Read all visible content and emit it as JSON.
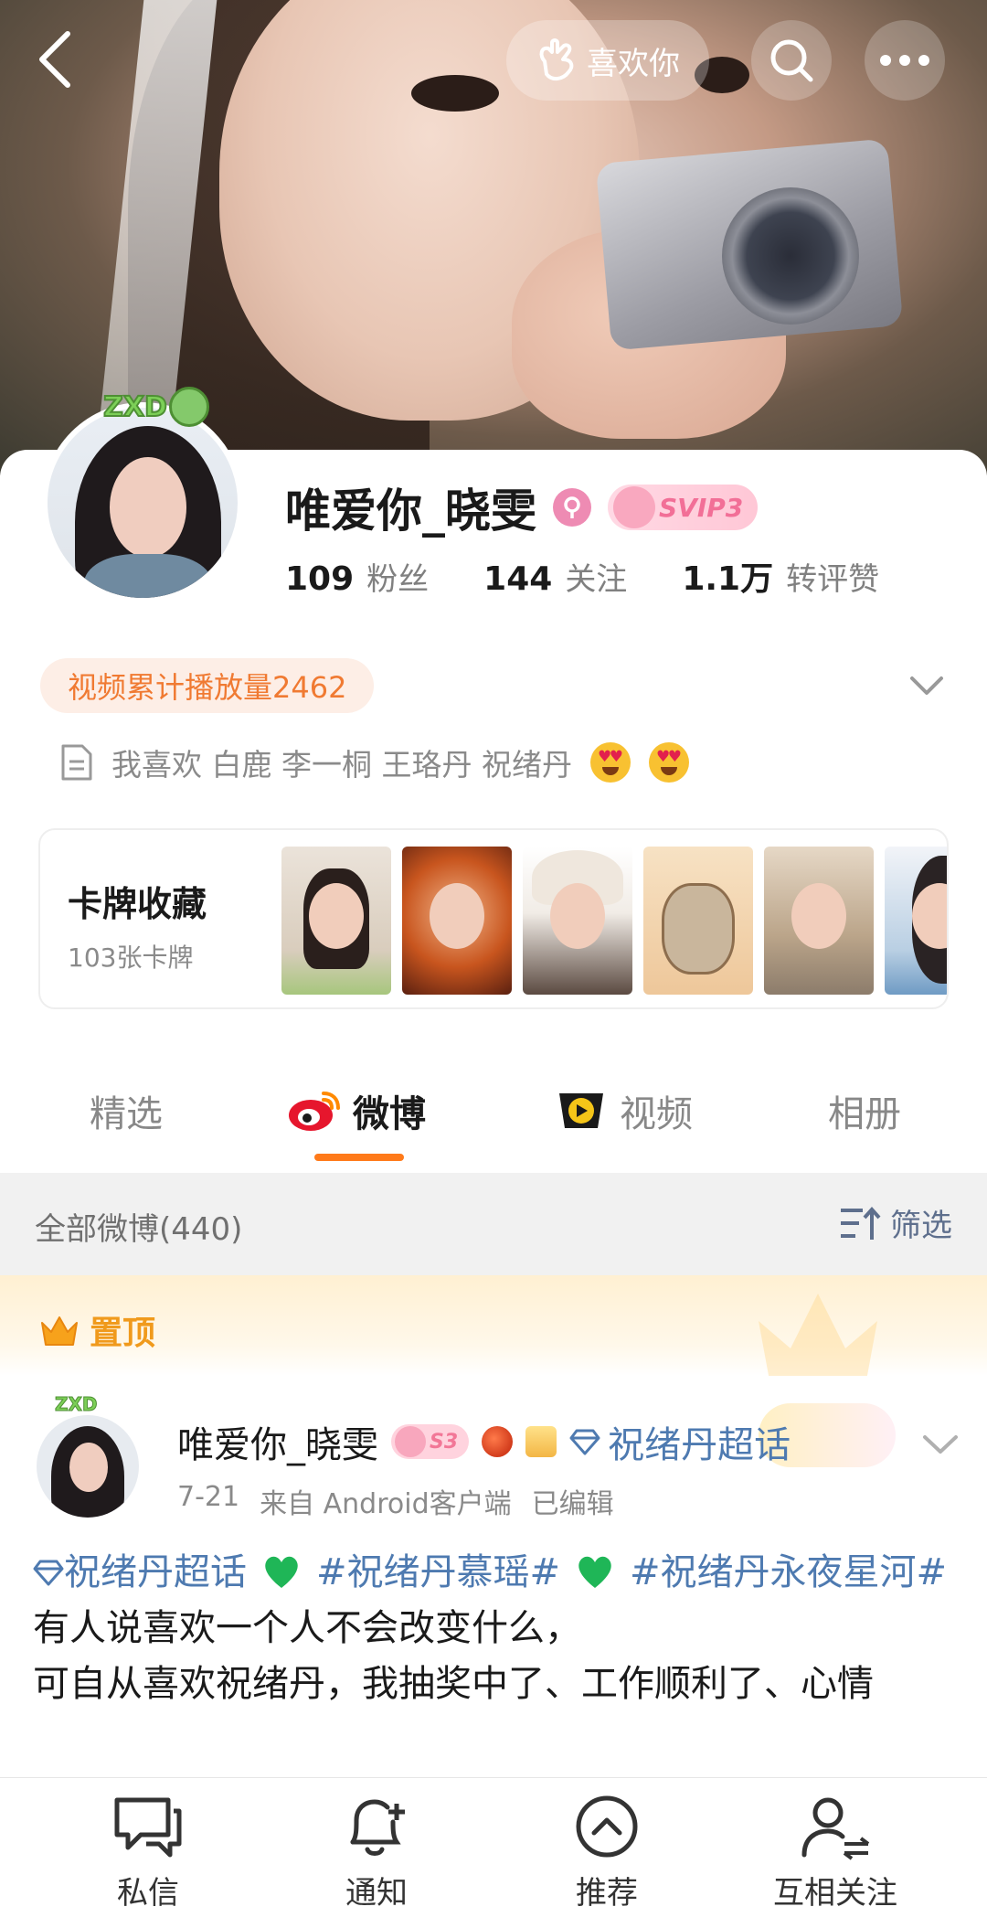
{
  "header": {
    "like_label": "喜欢你",
    "icons": {
      "back": "chevron-left-icon",
      "like": "hand-heart-icon",
      "search": "search-icon",
      "more": "more-dots-icon"
    }
  },
  "profile": {
    "avatar_badge": "ZXD",
    "name": "唯爱你_晓雯",
    "vip_label": "SVIP3",
    "stats": [
      {
        "num": "109",
        "label": "粉丝"
      },
      {
        "num": "144",
        "label": "关注"
      },
      {
        "num": "1.1万",
        "label": "转评赞"
      }
    ],
    "video_tag": "视频累计播放量2462",
    "bio": "我喜欢 白鹿 李一桐 王珞丹 祝绪丹",
    "bio_emoji": "heart-eyes-emoji"
  },
  "card_collection": {
    "title": "卡牌收藏",
    "count": "103张卡牌"
  },
  "tabs": [
    {
      "label": "精选"
    },
    {
      "label": "微博"
    },
    {
      "label": "视频"
    },
    {
      "label": "相册"
    }
  ],
  "feed": {
    "count_label": "全部微博(440)",
    "filter_label": "筛选",
    "pinned_label": "置顶"
  },
  "post": {
    "author": "唯爱你_晓雯",
    "level_badge": "S3",
    "super_topic": "祝绪丹超话",
    "date": "7-21",
    "source": "来自 Android客户端",
    "edited": "已编辑",
    "topic_1": "祝绪丹超话",
    "topic_2": "#祝绪丹慕瑶#",
    "topic_3": "#祝绪丹永夜星河#",
    "line_1": "有人说喜欢一个人不会改变什么，",
    "line_2": "可自从喜欢祝绪丹，我抽奖中了、工作顺利了、心情"
  },
  "bottom_nav": [
    {
      "label": "私信"
    },
    {
      "label": "通知"
    },
    {
      "label": "推荐"
    },
    {
      "label": "互相关注"
    }
  ],
  "colors": {
    "accent_orange": "#ff7a1a",
    "link_blue": "#4e7ab0",
    "tag_orange": "#f07a32",
    "pin_gold": "#f09a1c"
  }
}
